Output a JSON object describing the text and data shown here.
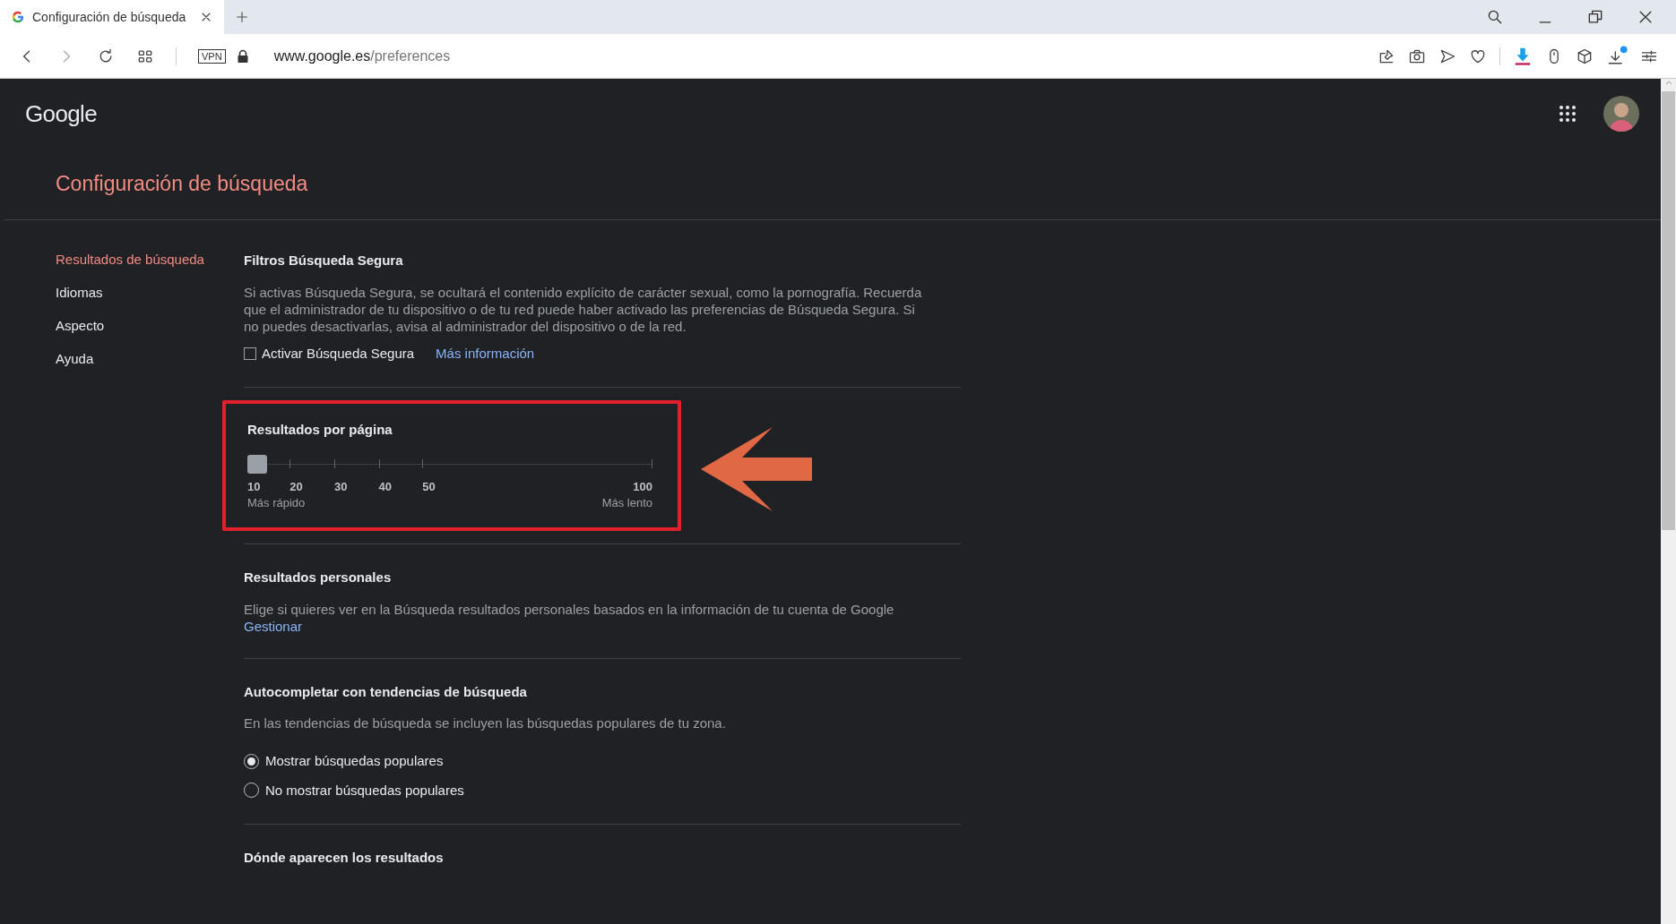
{
  "browser": {
    "tab": {
      "title": "Configuración de búsqueda",
      "selected": true
    },
    "url_host": "www.google.es",
    "url_path": "/preferences",
    "vpn_badge": "VPN"
  },
  "header": {
    "logo": "Google"
  },
  "page_title": "Configuración de búsqueda",
  "sidebar": {
    "items": [
      {
        "label": "Resultados de búsqueda",
        "selected": true
      },
      {
        "label": "Idiomas",
        "selected": false
      },
      {
        "label": "Aspecto",
        "selected": false
      },
      {
        "label": "Ayuda",
        "selected": false
      }
    ]
  },
  "sections": [
    {
      "kind": "checkbox",
      "title": "Filtros Búsqueda Segura",
      "text": "Si activas Búsqueda Segura, se ocultará el contenido explícito de carácter sexual, como la pornografía. Recuerda que el administrador de tu dispositivo o de tu red puede haber activado las preferencias de Búsqueda Segura. Si no puedes desactivarlas, avisa al administrador del dispositivo o de la red.",
      "checkbox": {
        "label": "Activar Búsqueda Segura",
        "checked": false
      },
      "link": "Más información"
    },
    {
      "kind": "slider",
      "title": "Resultados por página",
      "highlighted": true,
      "level": 0,
      "ticks": [
        "10",
        "20",
        "30",
        "40",
        "50",
        "100"
      ],
      "min_caption": "Más rápido",
      "max_caption": "Más lento"
    },
    {
      "kind": "text",
      "title": "Resultados personales",
      "text": "Elige si quieres ver en la Búsqueda resultados personales basados en la información de tu cuenta de Google",
      "link": "Gestionar"
    },
    {
      "kind": "radio",
      "title": "Autocompletar con tendencias de búsqueda",
      "text": "En las tendencias de búsqueda se incluyen las búsquedas populares de tu zona.",
      "options": [
        {
          "label": "Mostrar búsquedas populares",
          "selected": true
        },
        {
          "label": "No mostrar búsquedas populares",
          "selected": false
        }
      ]
    },
    {
      "kind": "heading",
      "title": "Dónde aparecen los resultados"
    }
  ]
}
